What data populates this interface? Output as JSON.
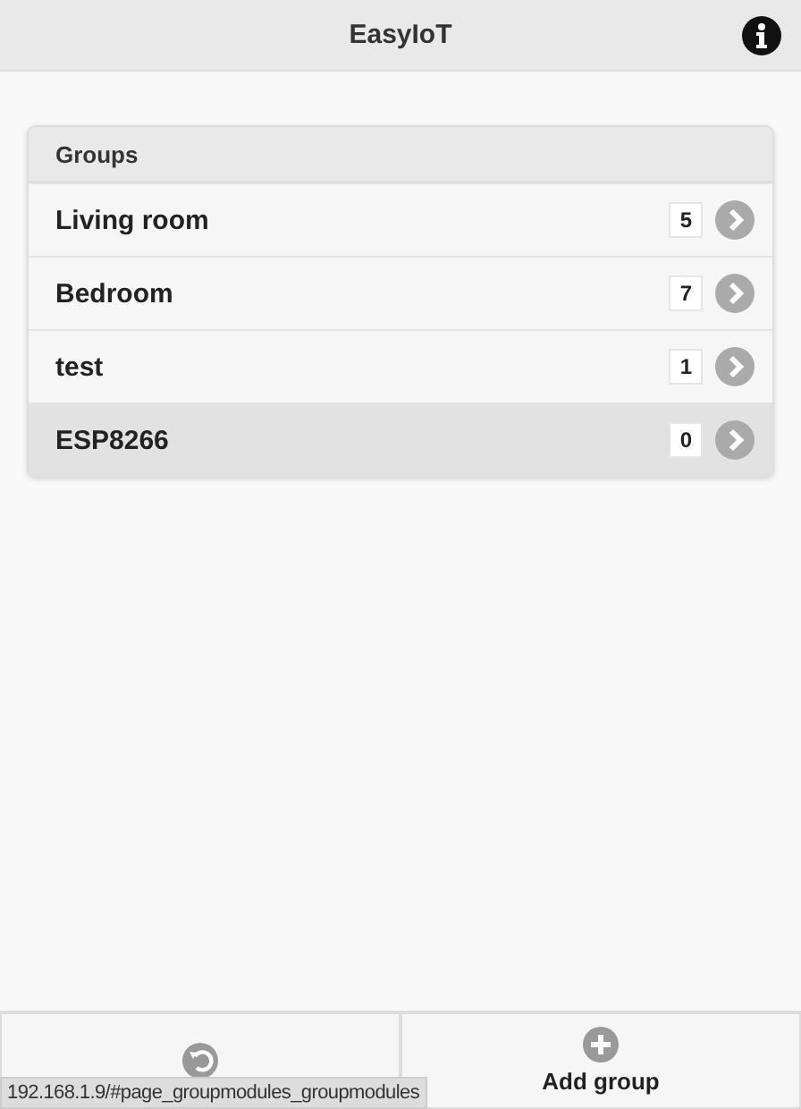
{
  "header": {
    "title": "EasyIoT"
  },
  "groups": {
    "title": "Groups",
    "items": [
      {
        "name": "Living room",
        "count": "5",
        "highlighted": false
      },
      {
        "name": "Bedroom",
        "count": "7",
        "highlighted": false
      },
      {
        "name": "test",
        "count": "1",
        "highlighted": false
      },
      {
        "name": "ESP8266",
        "count": "0",
        "highlighted": true
      }
    ]
  },
  "footer": {
    "buttons": [
      {
        "kind": "back"
      },
      {
        "kind": "add",
        "label": "Add group"
      }
    ]
  },
  "status_url": "192.168.1.9/#page_groupmodules_groupmodules"
}
